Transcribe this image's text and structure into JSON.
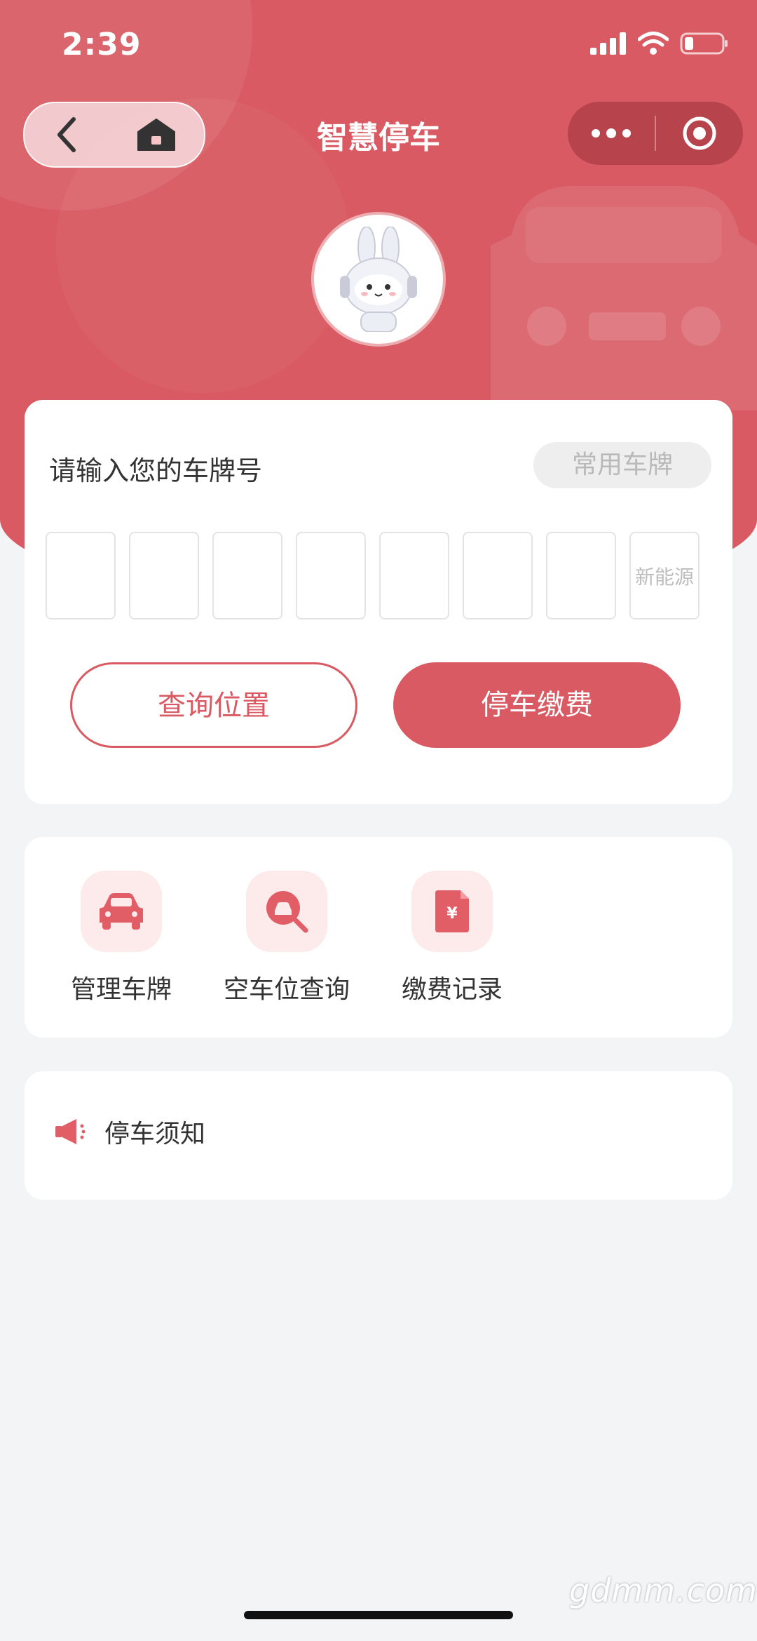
{
  "status_bar": {
    "time": "2:39"
  },
  "nav": {
    "title": "智慧停车"
  },
  "plate_card": {
    "prompt": "请输入您的车牌号",
    "common_plates_label": "常用车牌",
    "new_energy_label": "新能源",
    "query_button": "查询位置",
    "pay_button": "停车缴费"
  },
  "quick_actions": [
    {
      "label": "管理车牌",
      "icon": "car-icon"
    },
    {
      "label": "空车位查询",
      "icon": "search-car-icon"
    },
    {
      "label": "缴费记录",
      "icon": "receipt-yen-icon"
    }
  ],
  "notice": {
    "label": "停车须知",
    "icon": "megaphone-icon"
  },
  "watermark": "gdmm.com",
  "colors": {
    "accent": "#d95a62",
    "accent_light": "#fdeaea",
    "background": "#f3f4f6"
  }
}
